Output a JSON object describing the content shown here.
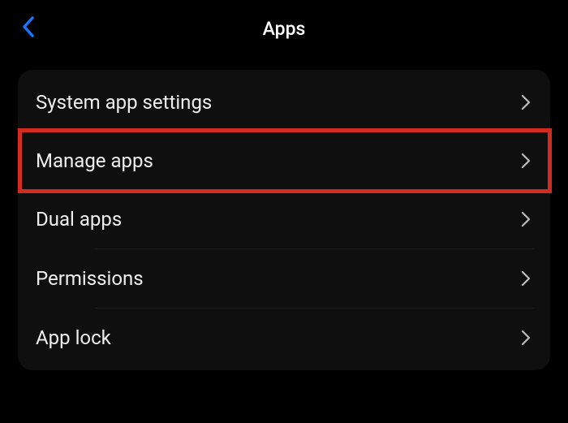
{
  "header": {
    "title": "Apps"
  },
  "menu": {
    "items": [
      {
        "label": "System app settings",
        "highlighted": false
      },
      {
        "label": "Manage apps",
        "highlighted": true
      },
      {
        "label": "Dual apps",
        "highlighted": false
      },
      {
        "label": "Permissions",
        "highlighted": false
      },
      {
        "label": "App lock",
        "highlighted": false
      }
    ]
  }
}
